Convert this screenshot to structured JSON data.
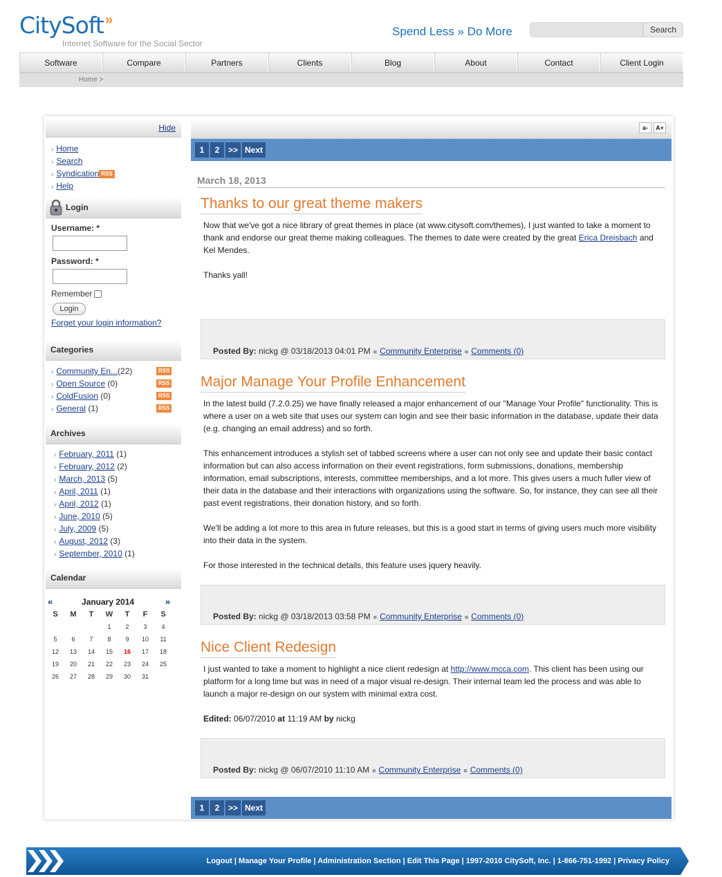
{
  "brand": {
    "name": "CitySoft",
    "tagline": "Internet Software for the Social Sector",
    "slogan": "Spend Less » Do More"
  },
  "search": {
    "button": "Search"
  },
  "nav": [
    "Software",
    "Compare",
    "Partners",
    "Clients",
    "Blog",
    "About",
    "Contact",
    "Client Login"
  ],
  "breadcrumb": "Home >",
  "sidebar": {
    "hide": "Hide",
    "links": [
      "Home",
      "Search",
      "Syndication",
      "Help"
    ],
    "rss_badge": "RSS",
    "login": {
      "title": "Login",
      "username_label": "Username: *",
      "password_label": "Password: *",
      "remember_label": "Remember",
      "button": "Login",
      "forgot": "Forget your login information?"
    },
    "categories": {
      "title": "Categories",
      "items": [
        {
          "name": "Community En...",
          "count": "(22)"
        },
        {
          "name": "Open Source",
          "count": "(0)"
        },
        {
          "name": "ColdFusion",
          "count": "(0)"
        },
        {
          "name": "General",
          "count": "(1)"
        }
      ]
    },
    "archives": {
      "title": "Archives",
      "items": [
        {
          "name": "February, 2011",
          "count": "(1)"
        },
        {
          "name": "February, 2012",
          "count": "(2)"
        },
        {
          "name": "March, 2013",
          "count": "(5)"
        },
        {
          "name": "April, 2011",
          "count": "(1)"
        },
        {
          "name": "April, 2012",
          "count": "(1)"
        },
        {
          "name": "June, 2010",
          "count": "(5)"
        },
        {
          "name": "July, 2009",
          "count": "(5)"
        },
        {
          "name": "August, 2012",
          "count": "(3)"
        },
        {
          "name": "September, 2010",
          "count": "(1)"
        }
      ]
    },
    "calendar": {
      "title": "Calendar",
      "month": "January 2014",
      "prev": "«",
      "next": "»",
      "dow": [
        "S",
        "M",
        "T",
        "W",
        "T",
        "F",
        "S"
      ],
      "weeks": [
        [
          "",
          "",
          "",
          "1",
          "2",
          "3",
          "4"
        ],
        [
          "5",
          "6",
          "7",
          "8",
          "9",
          "10",
          "11"
        ],
        [
          "12",
          "13",
          "14",
          "15",
          "16",
          "17",
          "18"
        ],
        [
          "19",
          "20",
          "21",
          "22",
          "23",
          "24",
          "25"
        ],
        [
          "26",
          "27",
          "28",
          "29",
          "30",
          "31",
          ""
        ]
      ],
      "today": "16"
    }
  },
  "main": {
    "font_small": "a-",
    "font_large": "A+",
    "pager": {
      "p1": "1",
      "p2": "2",
      "more": ">>",
      "next": "Next"
    },
    "date": "March 18, 2013",
    "posts": [
      {
        "title": "Thanks to our great theme makers",
        "p1_a": "Now that we've got a nice library of great themes in place (at www.citysoft.com/themes), I just wanted to take a moment to thank and endorse our great theme making colleagues.  The themes to date were created by the great ",
        "p1_link": "Erica Dreisbach",
        "p1_b": " and Kel Mendes.",
        "p2": "Thanks yall!",
        "posted_label": "Posted By:",
        "posted": "nickg @ 03/18/2013 04:01 PM",
        "category": "Community Enterprise",
        "comments": "Comments (0)"
      },
      {
        "title": "Major Manage Your Profile Enhancement",
        "p1": "In the latest build (7.2.0.25) we have finally released a major enhancement of our \"Manage Your Profile\" functionality.  This is where a user on a web site that uses our system can login and see their basic information in the database, update their data (e.g. changing an email address) and so forth.",
        "p2": "This enhancement introduces a stylish set of tabbed screens where a user can not only see and update their basic contact information but can also access information on their event registrations, form submissions, donations, membership information, email subscriptions, interests, committee memberships, and a lot more.  This gives users a much fuller view of their data in the database and their interactions with organizations using the software.  So, for instance, they can see all their past event registrations, their donation history, and so forth.",
        "p3": "We'll be adding a lot more to this area in future releases, but this is a good start in terms of giving users much more visibility into their data in the system.",
        "p4": "For those interested in the technical details, this feature uses jquery heavily.",
        "posted_label": "Posted By:",
        "posted": "nickg @ 03/18/2013 03:58 PM",
        "category": "Community Enterprise",
        "comments": "Comments (0)"
      },
      {
        "title": "Nice Client Redesign",
        "p1_a": "I just wanted to take a moment to highlight a nice client redesign at ",
        "p1_link": "http://www.mcca.com",
        "p1_b": ".  This client has been using our platform for a long time but was in need of a major visual re-design.  Their internal team led the process and was able to launch a major re-design on our system with minimal extra cost.",
        "edited_label": "Edited:",
        "edited_date": "06/07/2010",
        "at_label": "at",
        "edited_time": "11:19 AM",
        "by_label": "by",
        "edited_by": "nickg",
        "posted_label": "Posted By:",
        "posted": "nickg @ 06/07/2010 11:10 AM",
        "category": "Community Enterprise",
        "comments": "Comments (0)"
      }
    ]
  },
  "footer": {
    "links": [
      "Logout",
      "Manage Your Profile",
      "Administration Section",
      "Edit This Page",
      "1997-2010 CitySoft, Inc.",
      "1-866-751-1992",
      "Privacy Policy"
    ]
  },
  "colors": {
    "brand_blue": "#1f6fb8",
    "accent_orange": "#e27a2f",
    "pager_blue": "#5d8fc7",
    "footer_blue": "#1762a8"
  }
}
